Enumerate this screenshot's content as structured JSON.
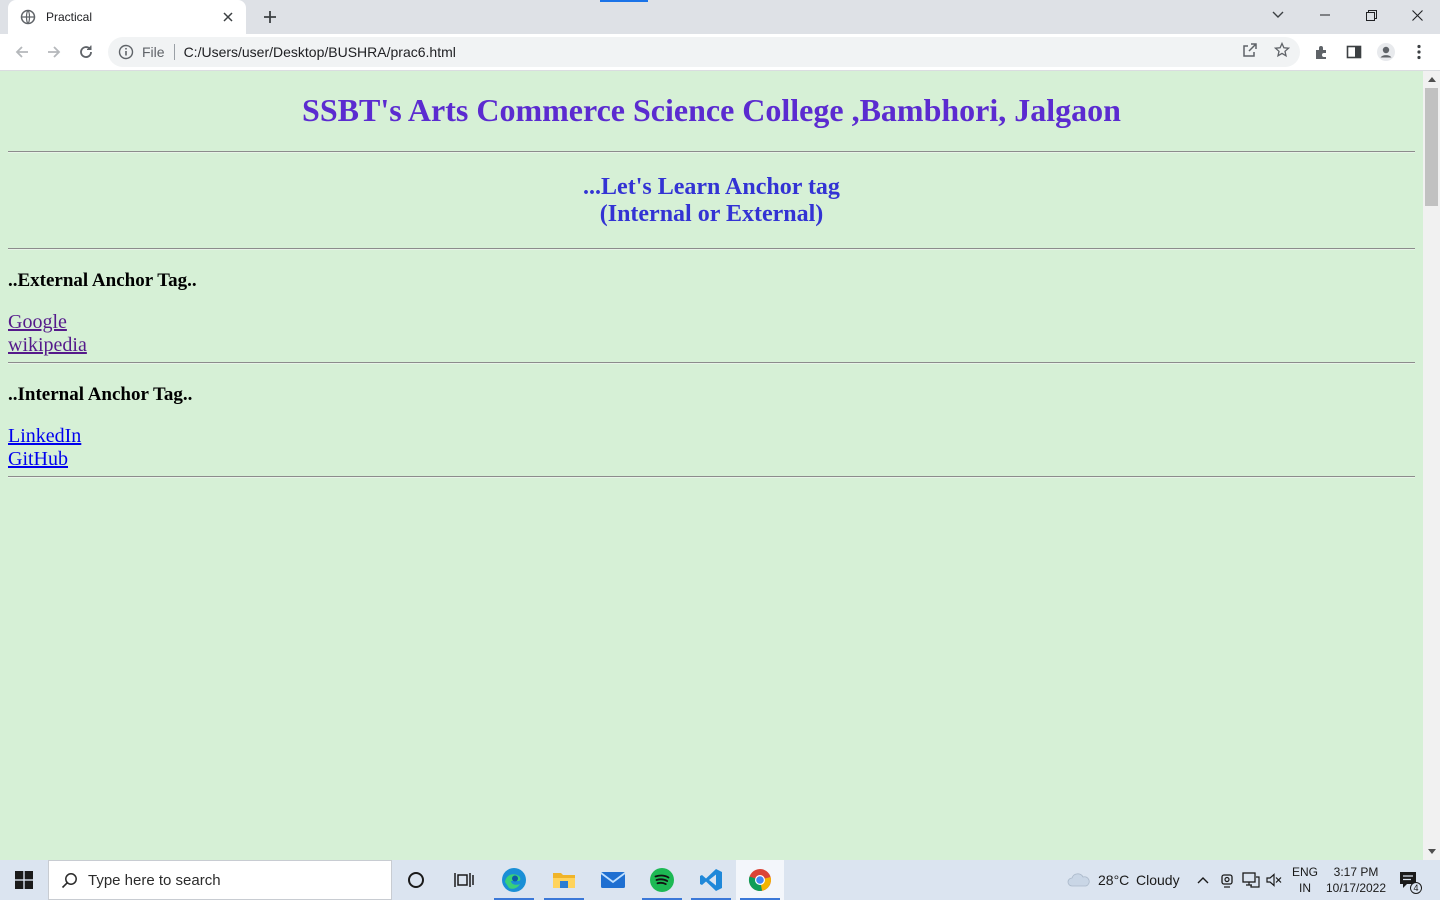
{
  "browser": {
    "tab_title": "Practical",
    "scheme_label": "File",
    "url": "C:/Users/user/Desktop/BUSHRA/prac6.html"
  },
  "page": {
    "college_heading": "SSBT's Arts Commerce Science College ,Bambhori, Jalgaon",
    "learn_line1": "...Let's Learn Anchor tag",
    "learn_line2": "(Internal or External)",
    "external_heading": "..External Anchor Tag..",
    "external_links": [
      "Google",
      "wikipedia"
    ],
    "internal_heading": "..Internal Anchor Tag..",
    "internal_links": [
      "LinkedIn",
      "GitHub"
    ],
    "colors": {
      "background": "#d6f0d6",
      "college_heading": "#5b2bd0",
      "learn_heading": "#3333d4",
      "visited_link": "#551a8b",
      "link": "#0000ee"
    }
  },
  "taskbar": {
    "search_placeholder": "Type here to search",
    "weather_temp": "28°C",
    "weather_text": "Cloudy",
    "lang_line1": "ENG",
    "lang_line2": "IN",
    "time": "3:17 PM",
    "date": "10/17/2022",
    "notification_count": "4",
    "apps": [
      "cortana-icon",
      "task-view-icon",
      "edge-icon",
      "file-explorer-icon",
      "mail-icon",
      "spotify-icon",
      "vscode-icon",
      "chrome-icon"
    ]
  }
}
